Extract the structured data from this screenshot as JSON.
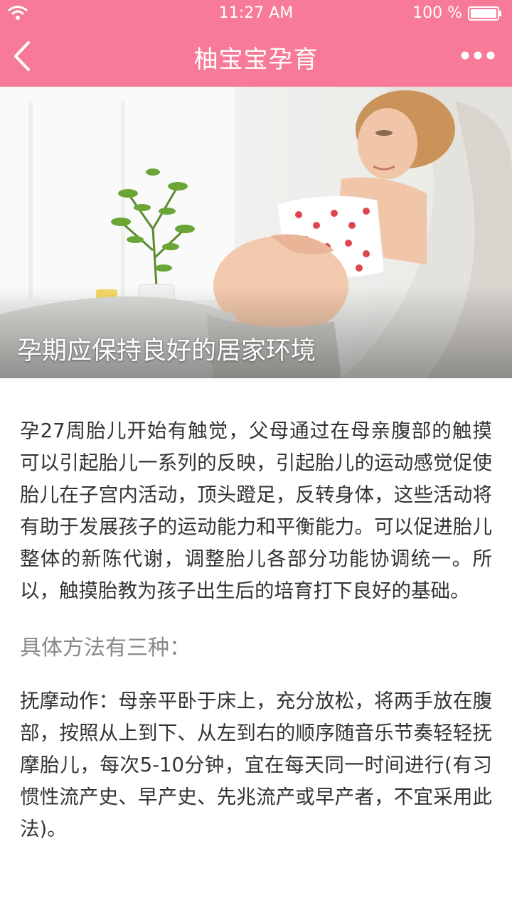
{
  "status_bar": {
    "time": "11:27 AM",
    "battery_text": "100 %",
    "wifi_icon": "wifi-icon",
    "battery_icon": "battery-icon"
  },
  "nav": {
    "title": "柚宝宝孕育",
    "back_icon": "back-chevron-icon",
    "more_icon": "more-dots-icon"
  },
  "article": {
    "hero_caption": "孕期应保持良好的居家环境",
    "intro": "孕27周胎儿开始有触觉，父母通过在母亲腹部的触摸可以引起胎儿一系列的反映，引起胎儿的运动感觉促使胎儿在子宫内活动，顶头蹬足，反转身体，这些活动将有助于发展孩子的运动能力和平衡能力。可以促进胎儿整体的新陈代谢，调整胎儿各部分功能协调统一。所以，触摸胎教为孩子出生后的培育打下良好的基础。",
    "methods_heading": "具体方法有三种：",
    "method_1": "抚摩动作：母亲平卧于床上，充分放松，将两手放在腹部，按照从上到下、从左到右的顺序随音乐节奏轻轻抚摩胎儿，每次5-10分钟，宜在每天同一时间进行(有习惯性流产史、早产史、先兆流产或早产者，不宜采用此法)。"
  },
  "colors": {
    "brand_pink": "#f77a98",
    "body_text": "#333333",
    "subhead_text": "#888888"
  }
}
